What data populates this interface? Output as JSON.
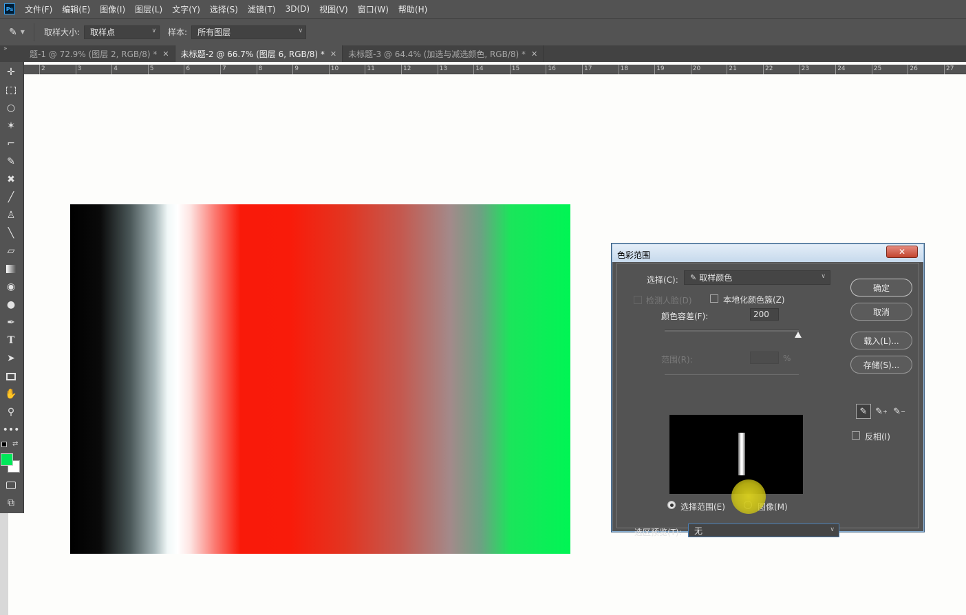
{
  "app": {
    "logo": "Ps"
  },
  "menu": [
    "文件(F)",
    "编辑(E)",
    "图像(I)",
    "图层(L)",
    "文字(Y)",
    "选择(S)",
    "滤镜(T)",
    "3D(D)",
    "视图(V)",
    "窗口(W)",
    "帮助(H)"
  ],
  "options": {
    "sample_size_label": "取样大小:",
    "sample_size_value": "取样点",
    "sample_label": "样本:",
    "sample_value": "所有图层"
  },
  "tabs": [
    {
      "label": "题-1 @ 72.9% (图层 2, RGB/8) *",
      "close": "✕"
    },
    {
      "label": "未标题-2 @ 66.7% (图层 6, RGB/8) *",
      "close": "✕"
    },
    {
      "label": "未标题-3 @ 64.4% (加选与减选颜色, RGB/8) *",
      "close": "✕"
    }
  ],
  "ruler_ticks": [
    "2",
    "3",
    "4",
    "5",
    "6",
    "7",
    "8",
    "9",
    "10",
    "11",
    "12",
    "13",
    "14",
    "15",
    "16",
    "17",
    "18",
    "19",
    "20",
    "21",
    "22",
    "23",
    "24",
    "25",
    "26",
    "27"
  ],
  "colors": {
    "foreground": "#00e85a",
    "background": "#ffffff",
    "accent": "#31a8ff"
  },
  "tools": [
    "move-icon",
    "marquee-icon",
    "lasso-icon",
    "magic-wand-icon",
    "crop-icon",
    "eyedropper-icon",
    "healing-icon",
    "brush-icon",
    "stamp-icon",
    "history-brush-icon",
    "eraser-icon",
    "gradient-icon",
    "blur-icon",
    "dodge-icon",
    "pen-icon",
    "type-icon",
    "path-select-icon",
    "rectangle-icon",
    "hand-icon",
    "zoom-icon",
    "more-icon"
  ],
  "dialog": {
    "title": "色彩范围",
    "close": "✕",
    "select_label": "选择(C):",
    "select_value": "取样颜色",
    "detect_faces": "检测人脸(D)",
    "localized": "本地化颜色簇(Z)",
    "fuzziness_label": "颜色容差(F):",
    "fuzziness_value": "200",
    "range_label": "范围(R):",
    "range_unit": "%",
    "selection_radio": "选择范围(E)",
    "image_radio": "图像(M)",
    "preview_label": "选区预览(T):",
    "preview_value": "无",
    "ok": "确定",
    "cancel": "取消",
    "load": "载入(L)...",
    "save": "存储(S)...",
    "invert": "反相(I)"
  }
}
